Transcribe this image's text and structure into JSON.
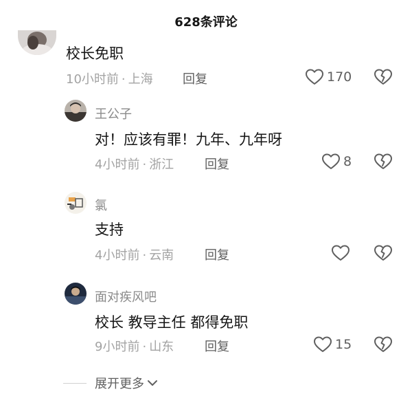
{
  "header": {
    "title": "628条评论"
  },
  "comments": [
    {
      "text": "校长免职",
      "time": "10小时前",
      "location": "上海",
      "reply_label": "回复",
      "likes": "170"
    }
  ],
  "replies": [
    {
      "name": "王公子",
      "text": "对！应该有罪！九年、九年呀",
      "time": "4小时前",
      "location": "浙江",
      "reply_label": "回复",
      "likes": "8"
    },
    {
      "name": "氯",
      "text": "支持",
      "time": "4小时前",
      "location": "云南",
      "reply_label": "回复",
      "likes": ""
    },
    {
      "name": "面对疾风吧",
      "text": "校长 教导主任 都得免职",
      "time": "9小时前",
      "location": "山东",
      "reply_label": "回复",
      "likes": "15"
    }
  ],
  "expand": {
    "label": "展开更多"
  },
  "colors": {
    "text": "#161616",
    "muted": "#a3a3a3",
    "name": "#8a8a8a",
    "icon": "#5f5f5f"
  }
}
